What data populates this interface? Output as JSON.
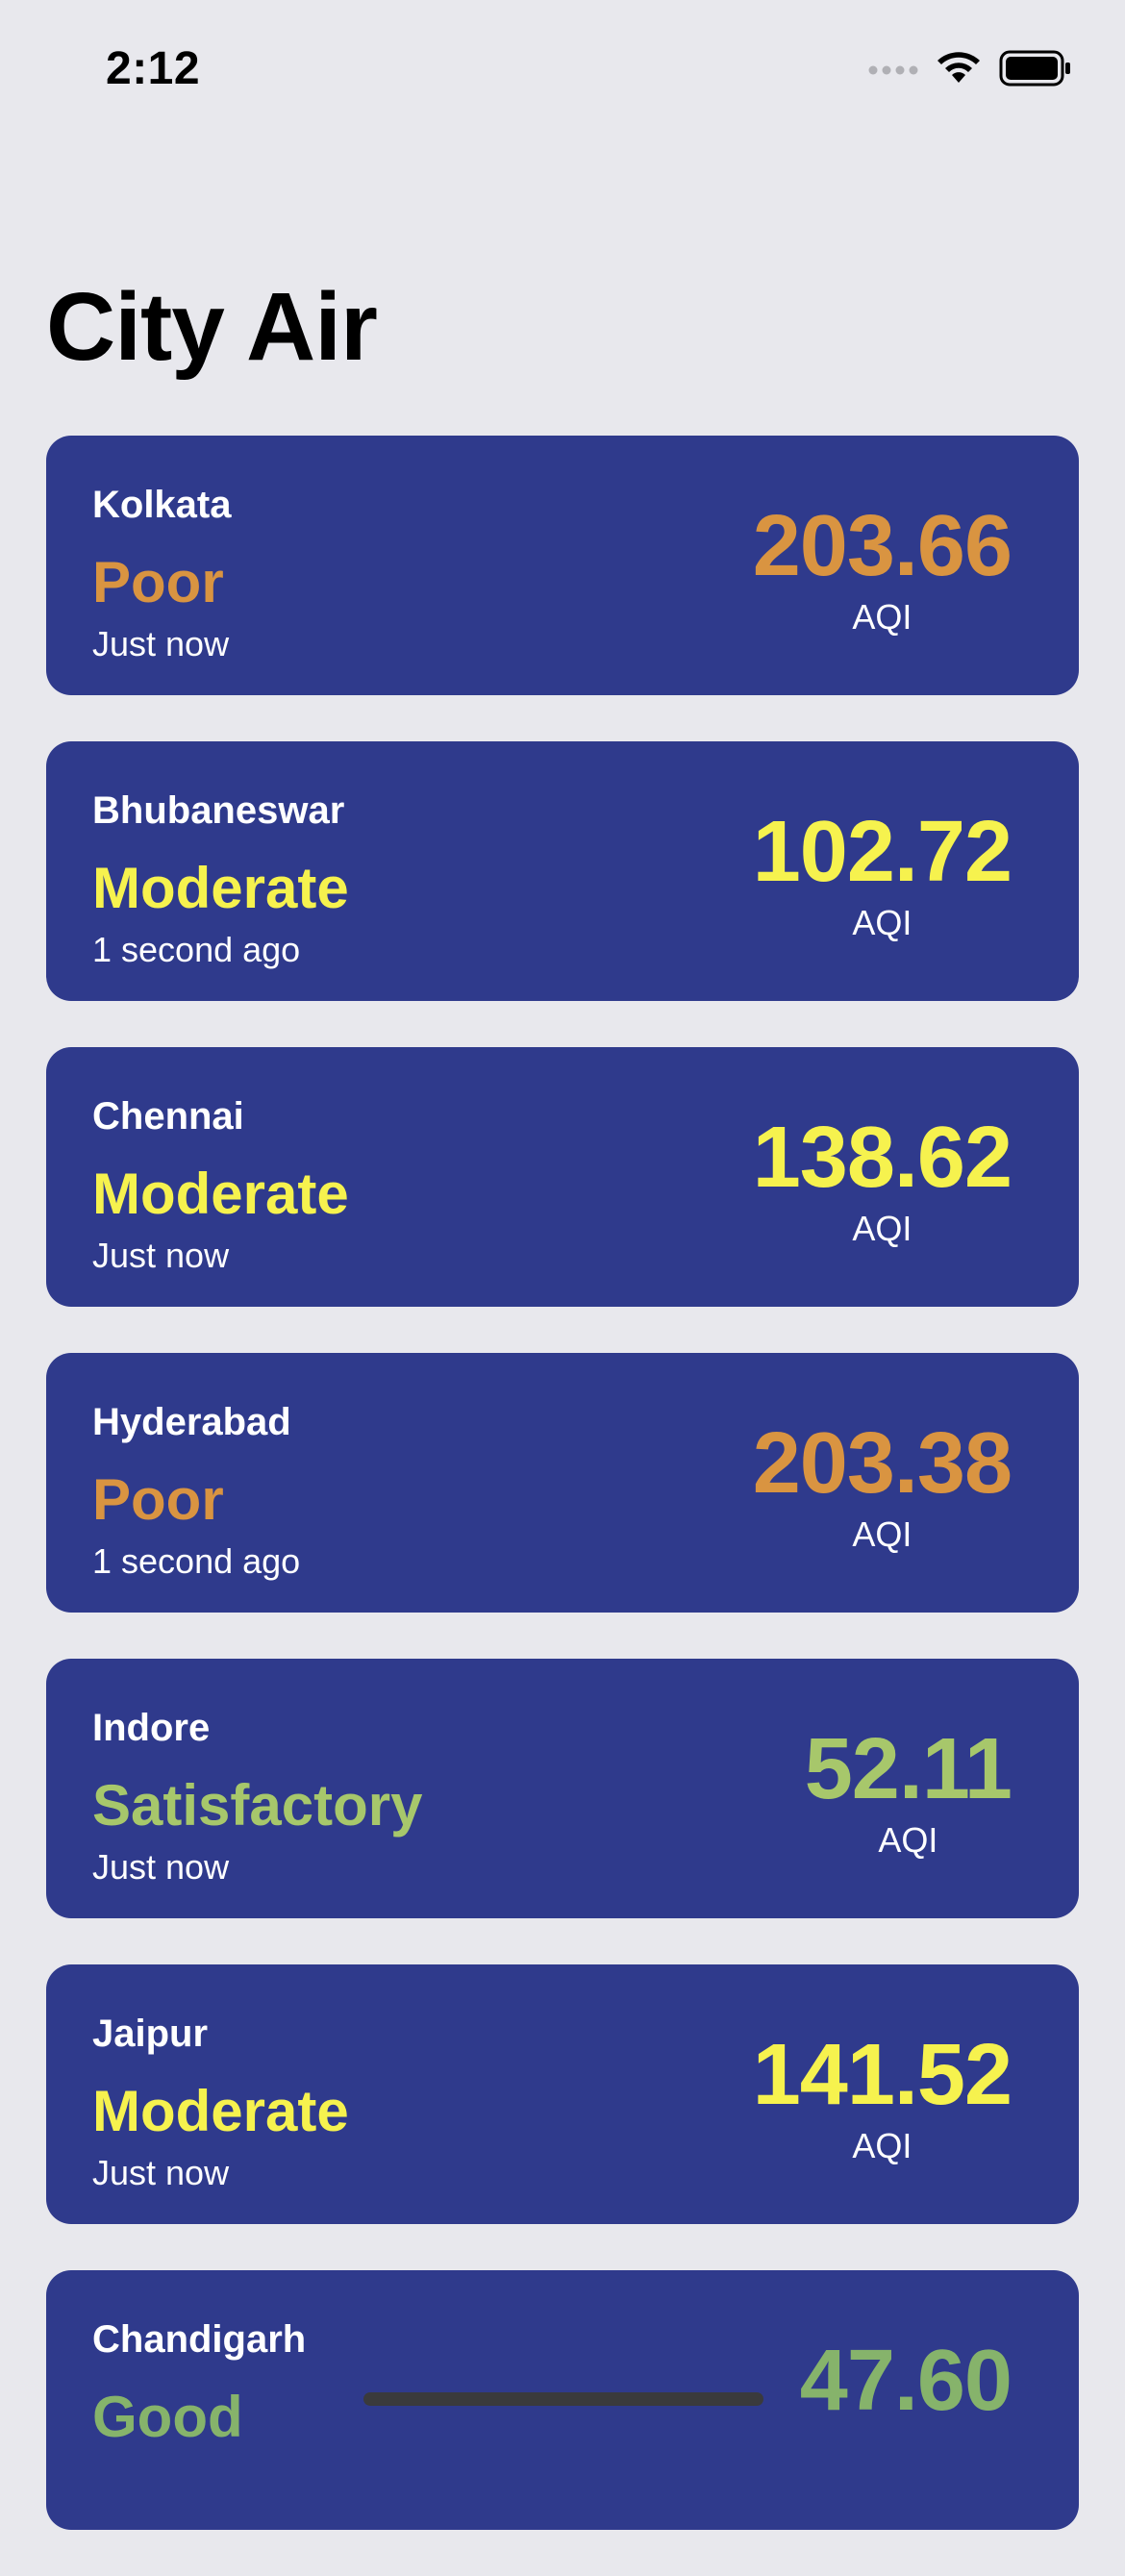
{
  "status_bar": {
    "time": "2:12",
    "icons": [
      "signal-dots-icon",
      "wifi-icon",
      "battery-icon"
    ]
  },
  "page": {
    "title": "City Air"
  },
  "colors": {
    "background": "#e8e8ed",
    "card": "#2f3a8c",
    "poor": "#d99441",
    "moderate": "#f6f24e",
    "satisfactory": "#a7c76b",
    "good": "#86b36b"
  },
  "cards": [
    {
      "city": "Kolkata",
      "category": "Poor",
      "updated": "Just now",
      "aqi": "203.66",
      "aqi_label": "AQI",
      "color": "#d99441"
    },
    {
      "city": "Bhubaneswar",
      "category": "Moderate",
      "updated": "1 second ago",
      "aqi": "102.72",
      "aqi_label": "AQI",
      "color": "#f6f24e"
    },
    {
      "city": "Chennai",
      "category": "Moderate",
      "updated": "Just now",
      "aqi": "138.62",
      "aqi_label": "AQI",
      "color": "#f6f24e"
    },
    {
      "city": "Hyderabad",
      "category": "Poor",
      "updated": "1 second ago",
      "aqi": "203.38",
      "aqi_label": "AQI",
      "color": "#d99441"
    },
    {
      "city": "Indore",
      "category": "Satisfactory",
      "updated": "Just now",
      "aqi": "52.11",
      "aqi_label": "AQI",
      "color": "#a7c76b"
    },
    {
      "city": "Jaipur",
      "category": "Moderate",
      "updated": "Just now",
      "aqi": "141.52",
      "aqi_label": "AQI",
      "color": "#f6f24e"
    },
    {
      "city": "Chandigarh",
      "category": "Good",
      "updated": "",
      "aqi": "47.60",
      "aqi_label": "",
      "color": "#86b36b"
    }
  ]
}
